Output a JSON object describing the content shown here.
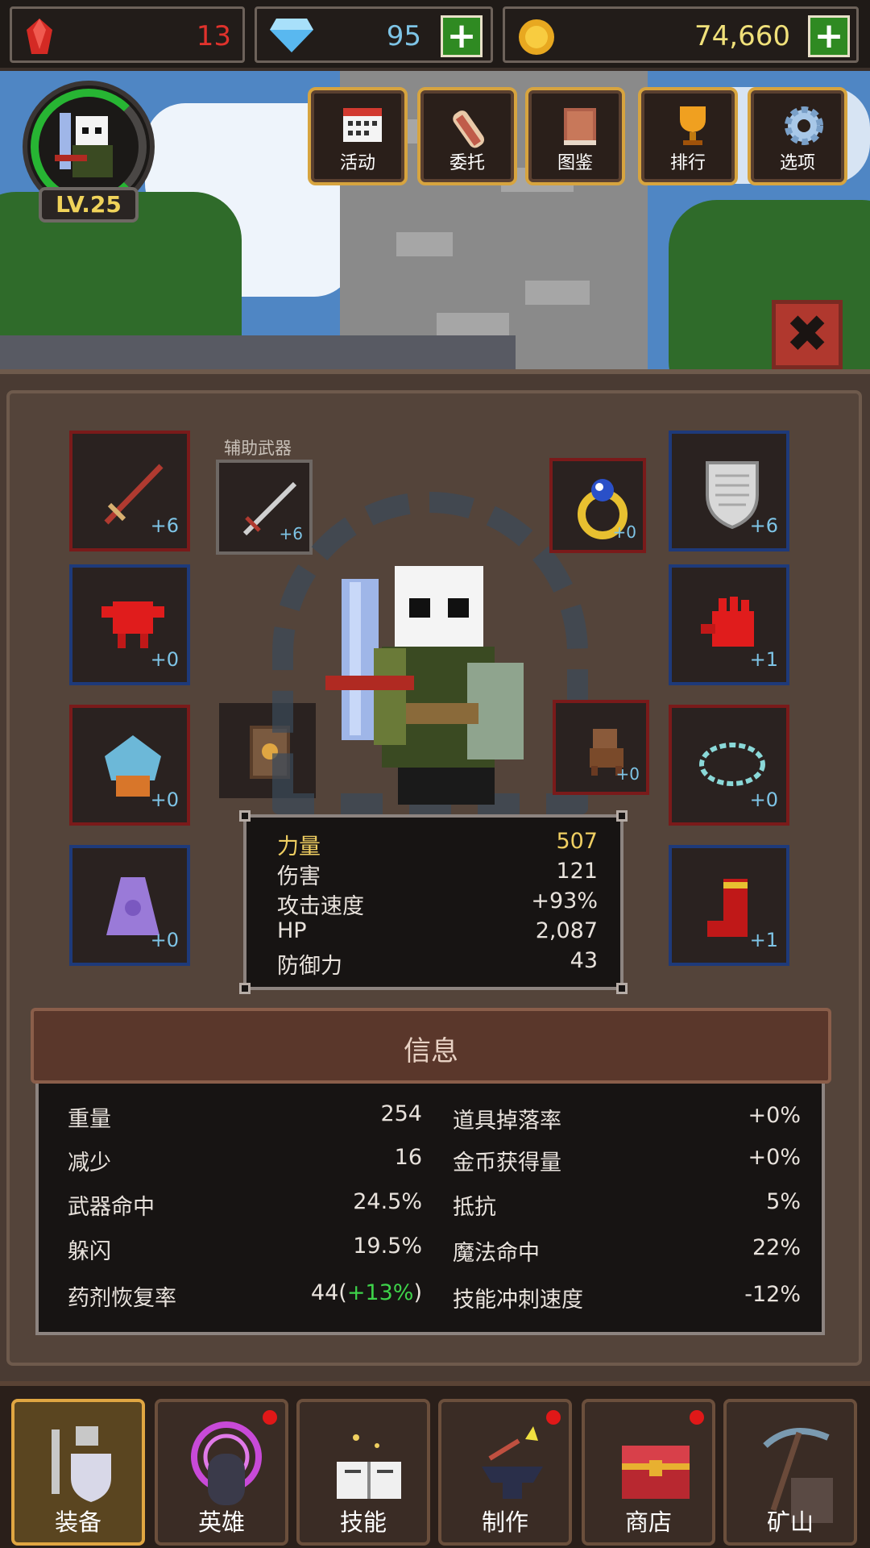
{
  "currency": {
    "gems": "13",
    "diamonds": "95",
    "gold": "74,660"
  },
  "player": {
    "level": "LV.25"
  },
  "menu": [
    {
      "label": "活动",
      "icon": "calendar-icon"
    },
    {
      "label": "委托",
      "icon": "scroll-icon"
    },
    {
      "label": "图鉴",
      "icon": "book-icon"
    },
    {
      "label": "排行",
      "icon": "trophy-icon"
    },
    {
      "label": "选项",
      "icon": "gear-icon"
    }
  ],
  "equipment": {
    "secondary_label": "辅助武器",
    "weapon": "+6",
    "secondary": "+6",
    "ring": "+0",
    "shield": "+6",
    "armor": "+0",
    "gloves": "+1",
    "helmet": "+0",
    "pet": "+0",
    "necklace": "+0",
    "cape": "+0",
    "boots": "+1"
  },
  "stats": [
    {
      "key": "力量",
      "value": "507"
    },
    {
      "key": "伤害",
      "value": "121"
    },
    {
      "key": "攻击速度",
      "value": "+93%"
    },
    {
      "key": "HP",
      "value": "2,087"
    },
    {
      "key": "防御力",
      "value": "43"
    }
  ],
  "info": {
    "title": "信息",
    "left": [
      {
        "key": "重量",
        "value": "254"
      },
      {
        "key": "减少",
        "value": "16"
      },
      {
        "key": "武器命中",
        "value": "24.5%"
      },
      {
        "key": "躲闪",
        "value": "19.5%"
      },
      {
        "key": "药剂恢复率",
        "value_base": "44(",
        "value_bonus": "+13%",
        "value_end": ")"
      }
    ],
    "right": [
      {
        "key": "道具掉落率",
        "value": "+0%"
      },
      {
        "key": "金币获得量",
        "value": "+0%"
      },
      {
        "key": "抵抗",
        "value": "5%"
      },
      {
        "key": "魔法命中",
        "value": "22%"
      },
      {
        "key": "技能冲刺速度",
        "value": "-12%"
      }
    ]
  },
  "nav": [
    {
      "label": "装备",
      "icon": "armor-icon",
      "active": true
    },
    {
      "label": "英雄",
      "icon": "hero-icon",
      "badge": true
    },
    {
      "label": "技能",
      "icon": "skill-book-icon"
    },
    {
      "label": "制作",
      "icon": "anvil-icon",
      "badge": true
    },
    {
      "label": "商店",
      "icon": "chest-icon",
      "badge": true
    },
    {
      "label": "矿山",
      "icon": "pickaxe-icon"
    }
  ],
  "colors": {
    "gem_red": "#e0322c",
    "diamond_blue": "#7ec4e6",
    "gold_yellow": "#f0e07a",
    "highlight": "#f0cf62",
    "plus_green": "#2f8a22"
  }
}
